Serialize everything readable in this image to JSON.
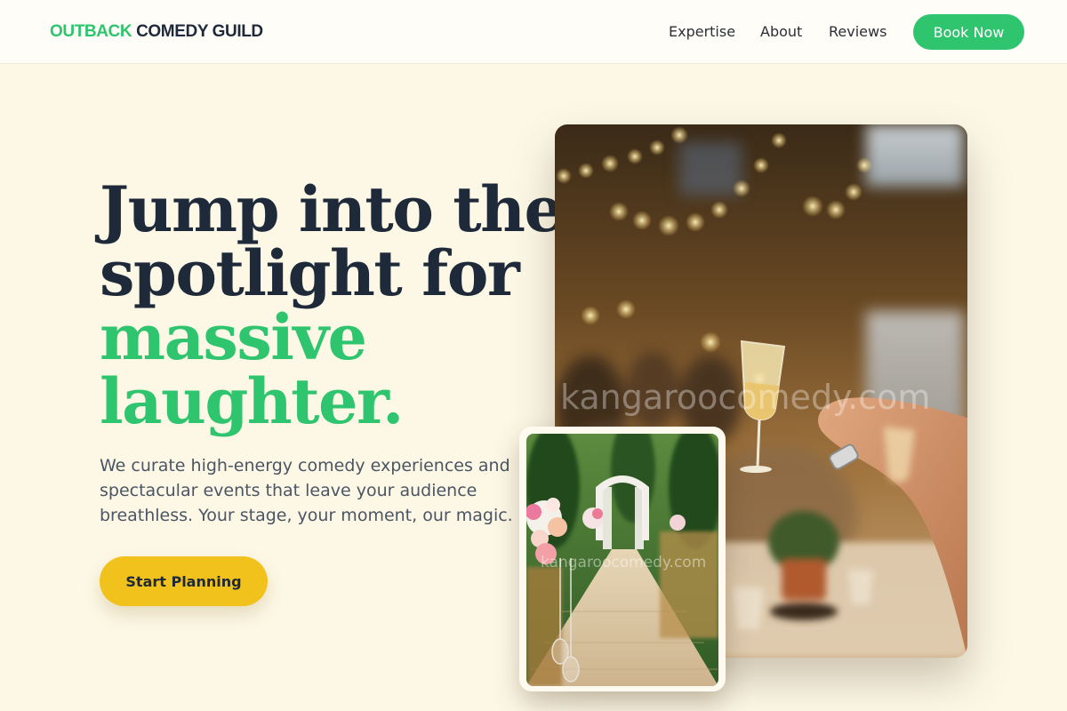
{
  "header": {
    "logo_primary": "OUTBACK",
    "logo_secondary": "COMEDY GUILD",
    "nav": [
      {
        "label": "Expertise"
      },
      {
        "label": "About"
      },
      {
        "label": "Reviews"
      }
    ],
    "cta_label": "Book Now"
  },
  "hero": {
    "headline_line1": "Jump into the",
    "headline_line2": "spotlight for",
    "headline_accent1": "massive",
    "headline_accent2": "laughter.",
    "subtext": "We curate high-energy comedy experiences and spectacular events that leave your audience breathless. Your stage, your moment, our magic.",
    "cta_label": "Start Planning"
  },
  "images": {
    "main_watermark": "kangaroocomedy.com",
    "inset_watermark": "kangaroocomedy.com"
  },
  "colors": {
    "brand_green": "#2fc46e",
    "cta_yellow": "#f1c21b",
    "page_bg": "#fdf8e6",
    "heading_dark": "#1e2a3a"
  }
}
